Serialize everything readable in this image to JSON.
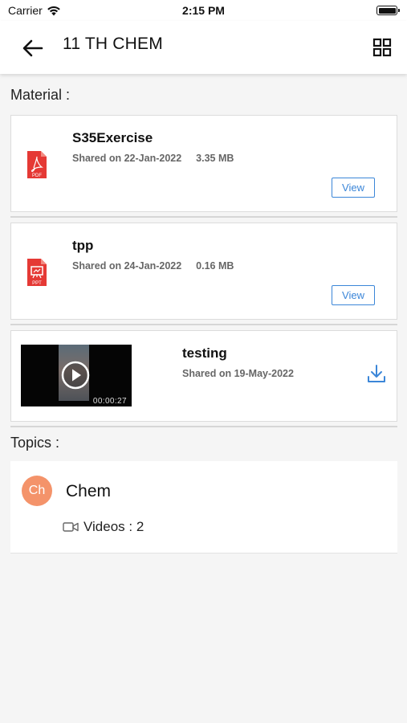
{
  "status_bar": {
    "carrier": "Carrier",
    "time": "2:15 PM"
  },
  "header": {
    "title": "11 TH CHEM",
    "back_icon": "arrow-left-icon",
    "grid_icon": "grid-view-icon"
  },
  "material": {
    "label": "Material :",
    "items": [
      {
        "type_icon": "pdf-file-icon",
        "type_text": "PDF",
        "name": "S35Exercise",
        "shared": "Shared on 22-Jan-2022",
        "size": "3.35 MB",
        "action": "View"
      },
      {
        "type_icon": "ppt-file-icon",
        "type_text": "PPT",
        "name": "tpp",
        "shared": "Shared on 24-Jan-2022",
        "size": "0.16 MB",
        "action": "View"
      }
    ],
    "video": {
      "name": "testing",
      "shared": "Shared on 19-May-2022",
      "duration": "00:00:27",
      "action_icon": "download-icon"
    }
  },
  "topics": {
    "label": "Topics :",
    "items": [
      {
        "avatar": "Ch",
        "avatar_color": "#f4936a",
        "name": "Chem",
        "videos_label": "Videos : 2"
      }
    ]
  },
  "colors": {
    "accent": "#3b86d8",
    "file_icon_red": "#e53935"
  }
}
